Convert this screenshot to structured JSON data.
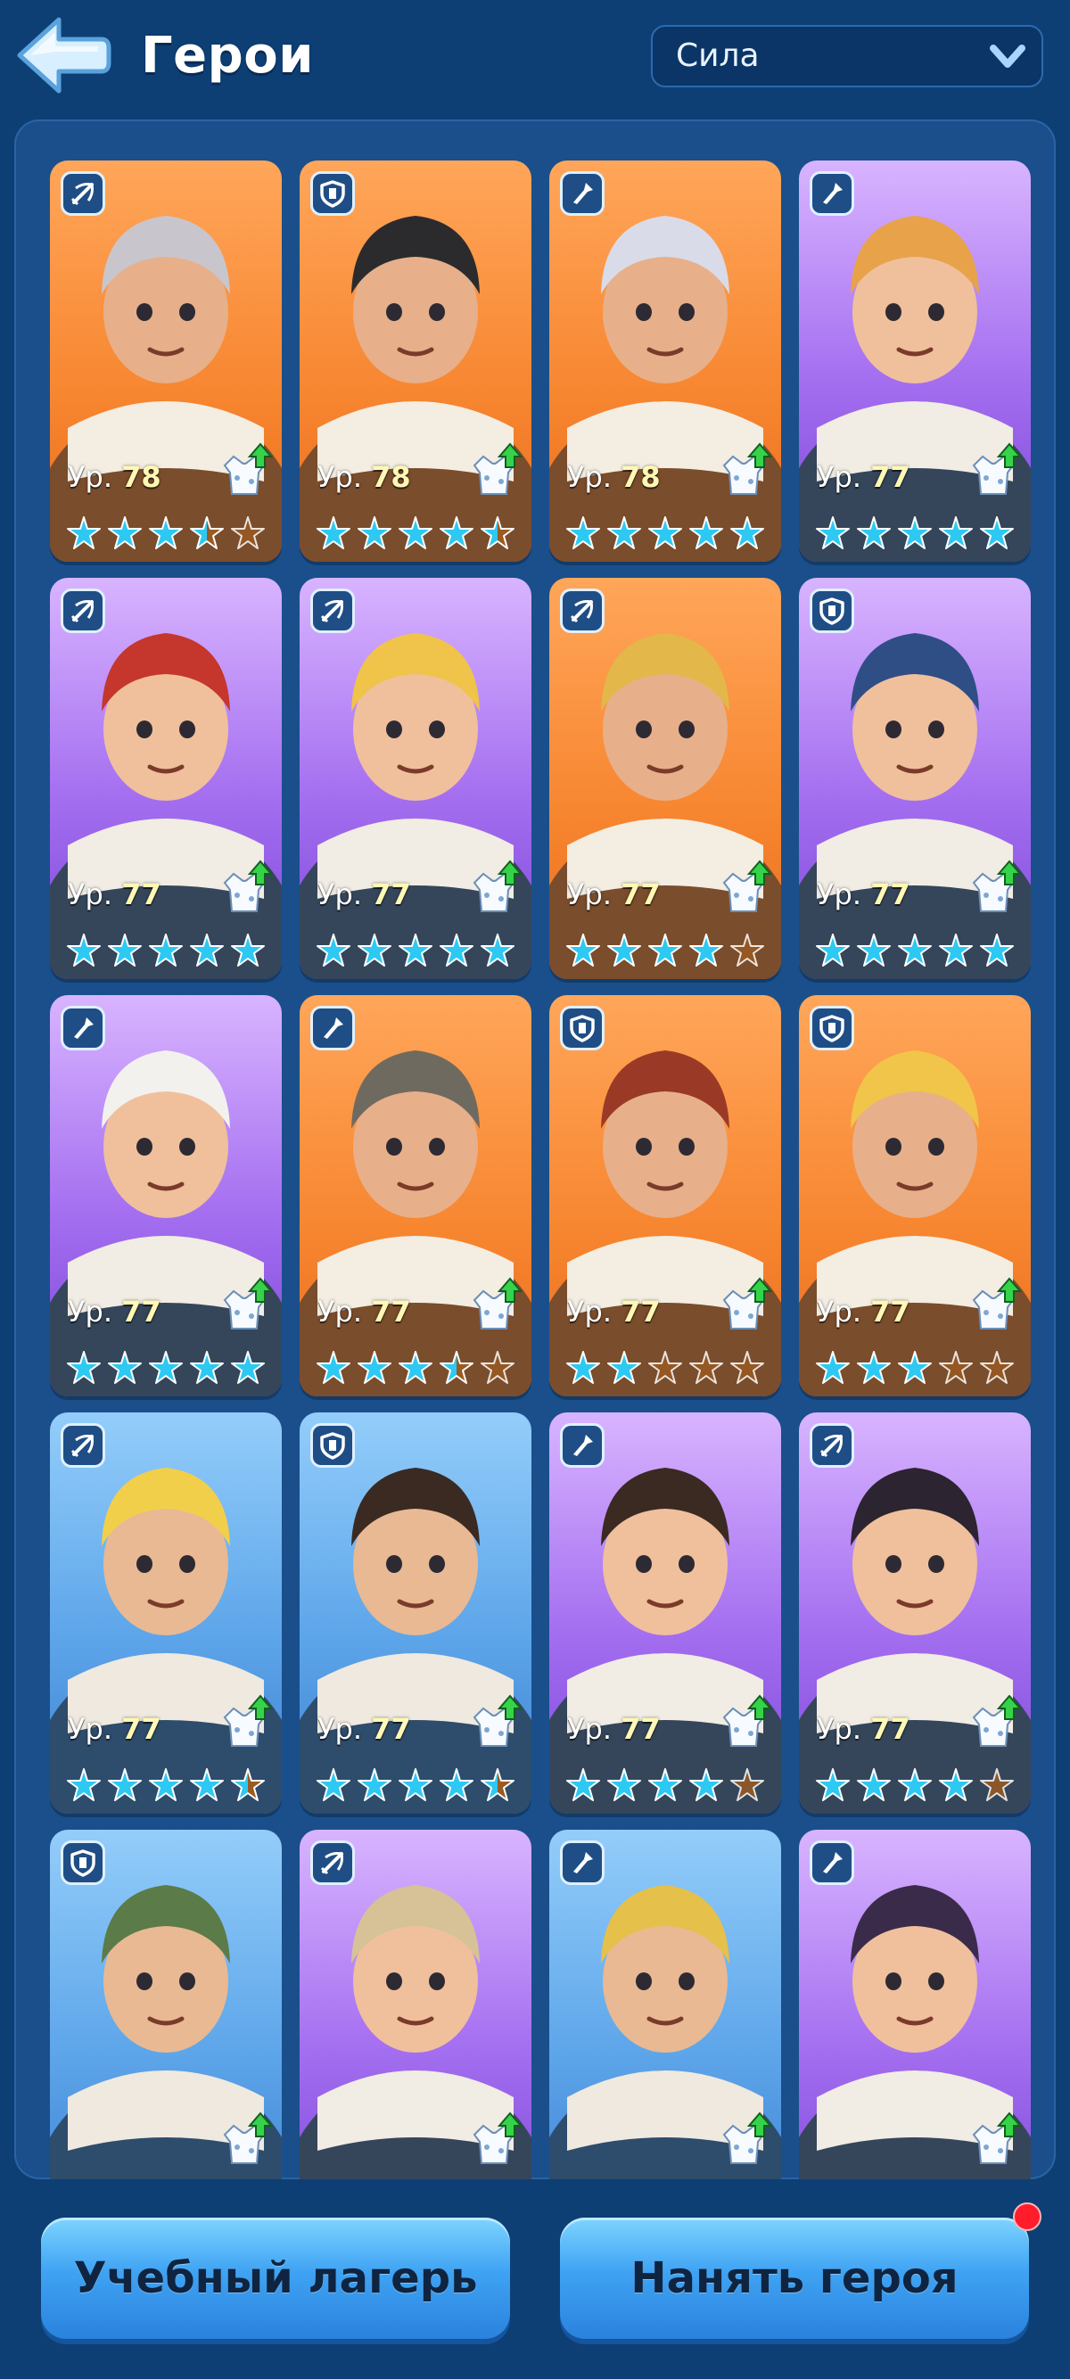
{
  "header": {
    "title": "Герои",
    "sort": {
      "selected": "Сила"
    }
  },
  "colors": {
    "orange_card": "#f7852f",
    "purple_card": "#a46ef0",
    "blue_card": "#5ea6ea",
    "active_star": "#2ec9f2",
    "inactive_star": "#9a5a22",
    "button": "#3fa3f3"
  },
  "level_prefix": "Ур.",
  "heroes": [
    {
      "bg": "orange",
      "class": "crossbow-icon",
      "level": "78",
      "stars": 3.5,
      "visible_footer": true
    },
    {
      "bg": "orange",
      "class": "shield-icon",
      "level": "78",
      "stars": 4.5,
      "visible_footer": true
    },
    {
      "bg": "orange",
      "class": "spear-icon",
      "level": "78",
      "stars": 5,
      "visible_footer": true
    },
    {
      "bg": "purple",
      "class": "spear-icon",
      "level": "77",
      "stars": 5,
      "visible_footer": true
    },
    {
      "bg": "purple",
      "class": "crossbow-icon",
      "level": "77",
      "stars": 5,
      "visible_footer": true
    },
    {
      "bg": "purple",
      "class": "crossbow-icon",
      "level": "77",
      "stars": 5,
      "visible_footer": true
    },
    {
      "bg": "orange",
      "class": "crossbow-icon",
      "level": "77",
      "stars": 4,
      "visible_footer": true
    },
    {
      "bg": "purple",
      "class": "shield-icon",
      "level": "77",
      "stars": 5,
      "visible_footer": true
    },
    {
      "bg": "purple",
      "class": "spear-icon",
      "level": "77",
      "stars": 5,
      "visible_footer": true
    },
    {
      "bg": "orange",
      "class": "spear-icon",
      "level": "77",
      "stars": 3.5,
      "visible_footer": true
    },
    {
      "bg": "orange",
      "class": "shield-icon",
      "level": "77",
      "stars": 2,
      "visible_footer": true
    },
    {
      "bg": "orange",
      "class": "shield-icon",
      "level": "77",
      "stars": 3,
      "visible_footer": true
    },
    {
      "bg": "blue",
      "class": "crossbow-icon",
      "level": "77",
      "stars": 4.5,
      "visible_footer": true
    },
    {
      "bg": "blue",
      "class": "shield-icon",
      "level": "77",
      "stars": 4.5,
      "visible_footer": true
    },
    {
      "bg": "purple",
      "class": "spear-icon",
      "level": "77",
      "stars": 4,
      "visible_footer": true
    },
    {
      "bg": "purple",
      "class": "crossbow-icon",
      "level": "77",
      "stars": 4,
      "visible_footer": true
    },
    {
      "bg": "blue",
      "class": "shield-icon",
      "level": "",
      "stars": 0,
      "visible_footer": false
    },
    {
      "bg": "purple",
      "class": "crossbow-icon",
      "level": "",
      "stars": 0,
      "visible_footer": false
    },
    {
      "bg": "blue",
      "class": "spear-icon",
      "level": "",
      "stars": 0,
      "visible_footer": false
    },
    {
      "bg": "purple",
      "class": "spear-icon",
      "level": "",
      "stars": 0,
      "visible_footer": false
    }
  ],
  "buttons": {
    "training_camp": "Учебный лагерь",
    "hire_hero": "Нанять героя"
  }
}
